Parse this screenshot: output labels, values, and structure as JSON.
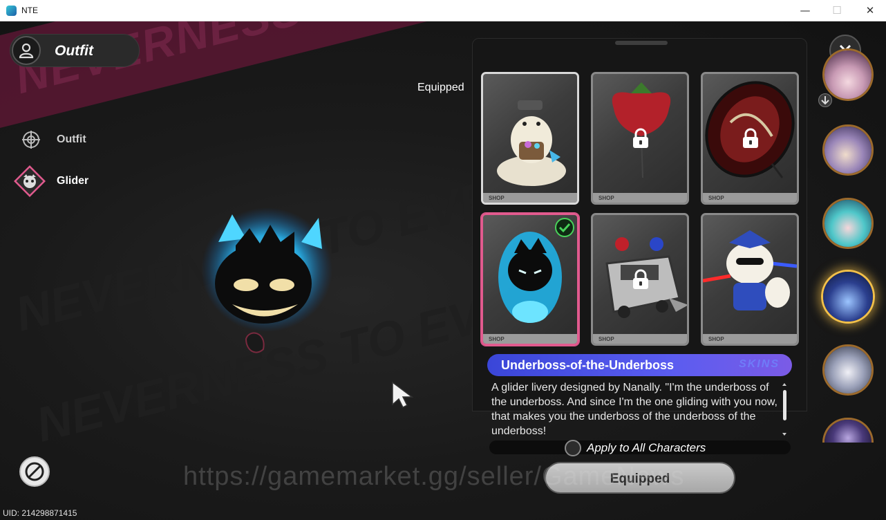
{
  "window": {
    "title": "NTE",
    "minimize": "—",
    "maximize": "☐",
    "close": "✕"
  },
  "header": {
    "title": "Outfit"
  },
  "nav": {
    "items": [
      {
        "label": "Outfit",
        "icon": "crosshair-icon",
        "active": false
      },
      {
        "label": "Glider",
        "icon": "glider-mask-icon",
        "active": true
      }
    ]
  },
  "background": {
    "banner_text": "NEVERNESS TO EVERNESS",
    "echo_text": "NEVERNESS TO EVERNESS"
  },
  "panel": {
    "equipped_label": "Equipped",
    "cards": [
      {
        "art": "white-dragon-glider",
        "locked": false,
        "equipped": true,
        "selected": false,
        "brand": "SHOP"
      },
      {
        "art": "strawberry-glider",
        "locked": true,
        "equipped": false,
        "selected": false,
        "brand": "SHOP"
      },
      {
        "art": "red-umbrella-glider",
        "locked": true,
        "equipped": false,
        "selected": false,
        "brand": "SHOP"
      },
      {
        "art": "underboss-blue-flame-glider",
        "locked": false,
        "equipped": false,
        "selected": true,
        "brand": "SHOP"
      },
      {
        "art": "police-car-glider",
        "locked": true,
        "equipped": false,
        "selected": false,
        "brand": "SHOP"
      },
      {
        "art": "police-hamster-glider",
        "locked": false,
        "equipped": false,
        "selected": false,
        "brand": "SHOP"
      }
    ]
  },
  "detail": {
    "name": "Underboss-of-the-Underboss",
    "category_tag": "SKINS",
    "description": "A glider livery designed by Nanally. \"I'm the underboss of the underboss. And since I'm the one gliding with you now, that makes you the underboss of the underboss of the underboss!",
    "apply_all_label": "Apply to All Characters",
    "equip_button": "Equipped"
  },
  "watermark": "https://gamemarket.gg/seller/GameNews",
  "uid": "UID: 214298871415",
  "colors": {
    "accent_pink": "#e15a8e",
    "name_bar_blue": "#4a4fe6",
    "portrait_gold": "#f2c04a",
    "banner_magenta": "#5a1733"
  }
}
